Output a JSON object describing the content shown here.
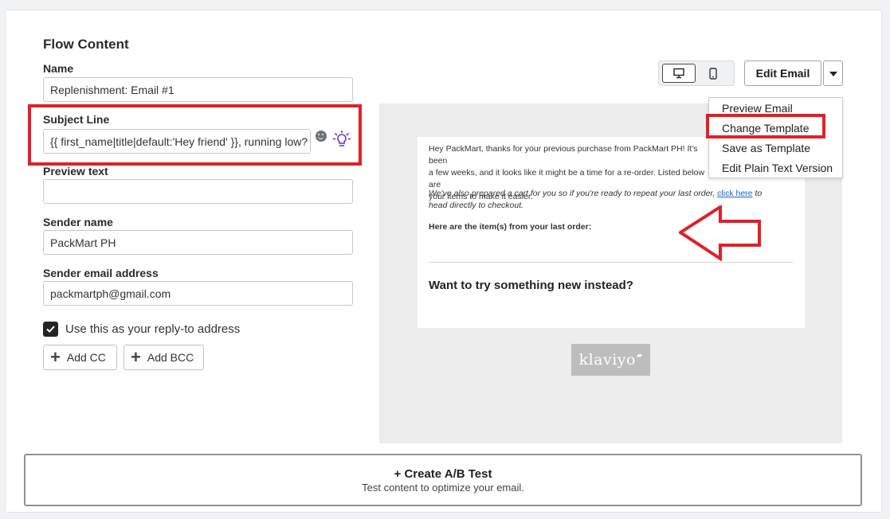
{
  "flow_content": {
    "title": "Flow Content",
    "name": {
      "label": "Name",
      "value": "Replenishment: Email #1"
    },
    "subject_line": {
      "label": "Subject Line",
      "value": "{{ first_name|title|default:'Hey friend' }}, running low?"
    },
    "preview_text": {
      "label": "Preview text",
      "value": ""
    },
    "sender_name": {
      "label": "Sender name",
      "value": "PackMart PH"
    },
    "sender_email": {
      "label": "Sender email address",
      "value": "packmartph@gmail.com"
    },
    "reply_to": {
      "label": "Use this as your reply-to address",
      "checked": true
    },
    "add_cc_label": "Add CC",
    "add_bcc_label": "Add BCC"
  },
  "toolbar": {
    "edit_email_label": "Edit Email"
  },
  "dropdown": {
    "items": [
      "Preview Email",
      "Change Template",
      "Save as Template",
      "Edit Plain Text Version"
    ]
  },
  "preview": {
    "para1_line1": "Hey PackMart, thanks for your previous purchase from PackMart PH! It's been",
    "para1_line2": "a few weeks, and it looks like it might be a time for a re-order. Listed below are",
    "para1_line3": "your items to make it easier.",
    "para2_line1_pre": "We've also prepared a cart for you so if you're ready to repeat your last order, ",
    "para2_link": "click here",
    "para2_line1_post": " to",
    "para2_line2": "head directly to checkout.",
    "items_heading": "Here are the item(s) from your last order:",
    "cta_heading": "Want to try something new instead?",
    "footer_logo": "klaviyo"
  },
  "ab_test": {
    "title": "+ Create A/B Test",
    "subtitle": "Test content to optimize your email."
  },
  "colors": {
    "annotation_red": "#e0202a",
    "link_blue": "#1a5fd6",
    "lightbulb_purple": "#6b2fd6"
  }
}
